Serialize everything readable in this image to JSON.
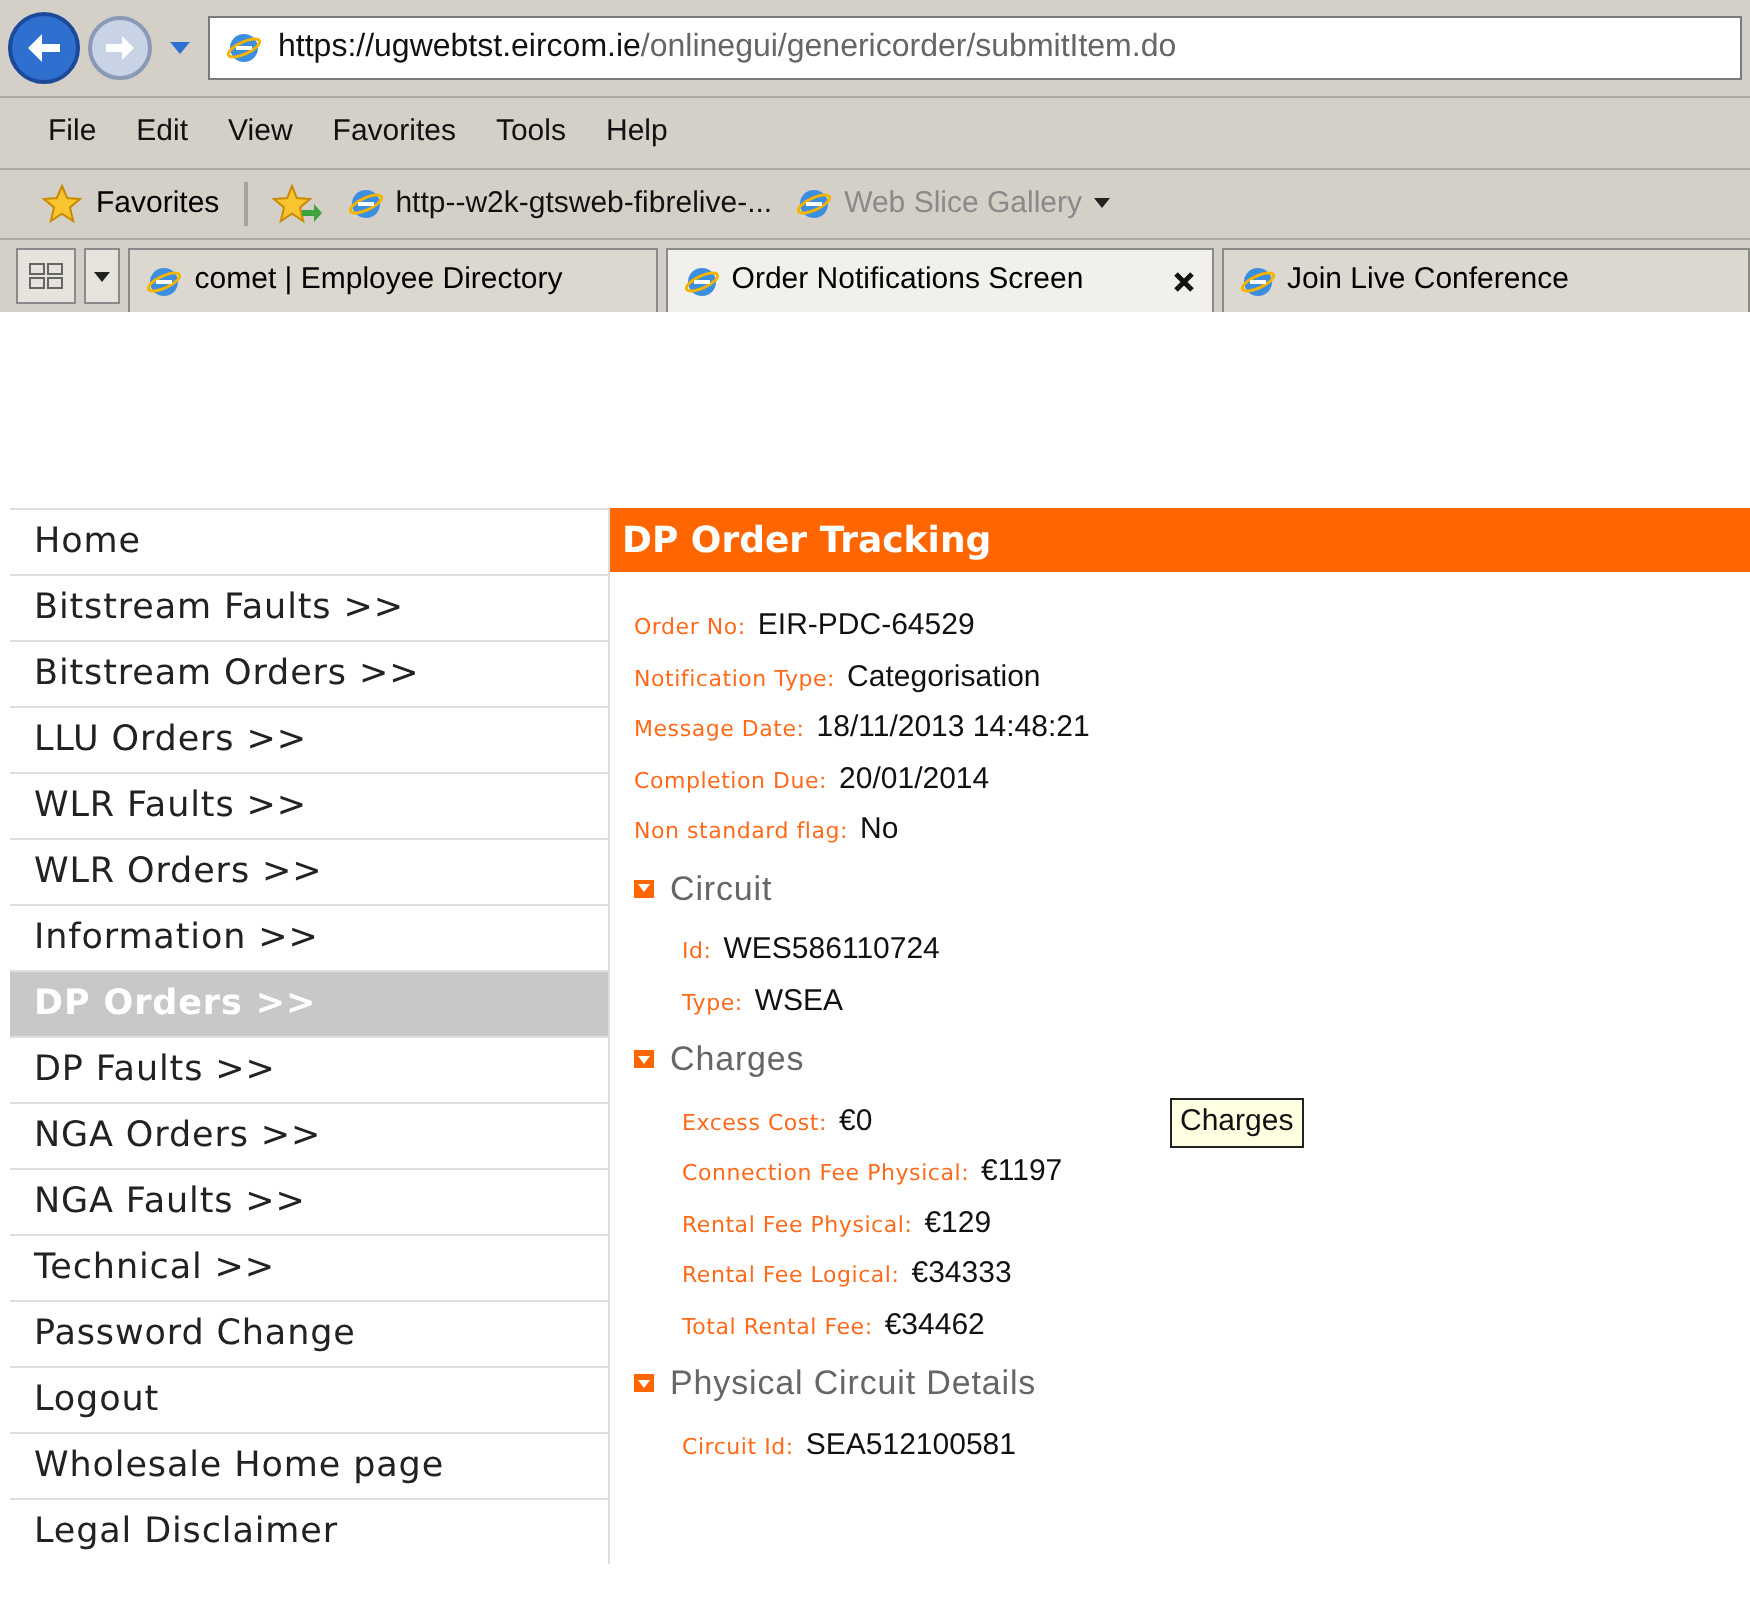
{
  "browser": {
    "address_host": "https://ugwebtst.eircom.ie",
    "address_path": "/onlinegui/genericorder/submitItem.do",
    "menu": [
      "File",
      "Edit",
      "View",
      "Favorites",
      "Tools",
      "Help"
    ],
    "favorites_label": "Favorites",
    "favorites_links": [
      {
        "label": "http--w2k-gtsweb-fibrelive-...",
        "disabled": false
      },
      {
        "label": "Web Slice Gallery",
        "disabled": true
      }
    ],
    "tabs": [
      {
        "label": "comet | Employee Directory",
        "selected": false
      },
      {
        "label": "Order Notifications Screen",
        "selected": true
      },
      {
        "label": "Join Live Conference",
        "selected": false
      }
    ]
  },
  "sidebar": {
    "items": [
      {
        "label": "Home",
        "selected": false
      },
      {
        "label": "Bitstream Faults >>",
        "selected": false
      },
      {
        "label": "Bitstream Orders >>",
        "selected": false
      },
      {
        "label": "LLU Orders >>",
        "selected": false
      },
      {
        "label": "WLR Faults >>",
        "selected": false
      },
      {
        "label": "WLR Orders >>",
        "selected": false
      },
      {
        "label": "Information >>",
        "selected": false
      },
      {
        "label": "DP Orders >>",
        "selected": true
      },
      {
        "label": "DP Faults >>",
        "selected": false
      },
      {
        "label": "NGA Orders >>",
        "selected": false
      },
      {
        "label": "NGA Faults >>",
        "selected": false
      },
      {
        "label": "Technical >>",
        "selected": false
      },
      {
        "label": "Password Change",
        "selected": false
      },
      {
        "label": "Logout",
        "selected": false
      },
      {
        "label": "Wholesale Home page",
        "selected": false
      },
      {
        "label": "Legal Disclaimer",
        "selected": false
      }
    ]
  },
  "panel": {
    "title": "DP Order Tracking",
    "fields": [
      {
        "label": "Order No:",
        "value": "EIR-PDC-64529"
      },
      {
        "label": "Notification Type:",
        "value": "Categorisation"
      },
      {
        "label": "Message Date:",
        "value": "18/11/2013 14:48:21"
      },
      {
        "label": "Completion Due:",
        "value": "20/01/2014"
      },
      {
        "label": "Non standard flag:",
        "value": "No"
      }
    ],
    "sections": [
      {
        "title": "Circuit",
        "expanded": true,
        "fields": [
          {
            "label": "Id:",
            "value": "WES586110724"
          },
          {
            "label": "Type:",
            "value": "WSEA"
          }
        ]
      },
      {
        "title": "Charges",
        "expanded": true,
        "tooltip": "Charges",
        "fields": [
          {
            "label": "Excess Cost:",
            "value": "€0"
          },
          {
            "label": "Connection Fee Physical:",
            "value": "€1197"
          },
          {
            "label": "Rental Fee Physical:",
            "value": "€129"
          },
          {
            "label": "Rental Fee Logical:",
            "value": "€34333"
          },
          {
            "label": "Total Rental Fee:",
            "value": "€34462"
          }
        ]
      },
      {
        "title": "Physical Circuit Details",
        "expanded": true,
        "fields": [
          {
            "label": "Circuit Id:",
            "value": "SEA512100581"
          }
        ]
      }
    ]
  }
}
